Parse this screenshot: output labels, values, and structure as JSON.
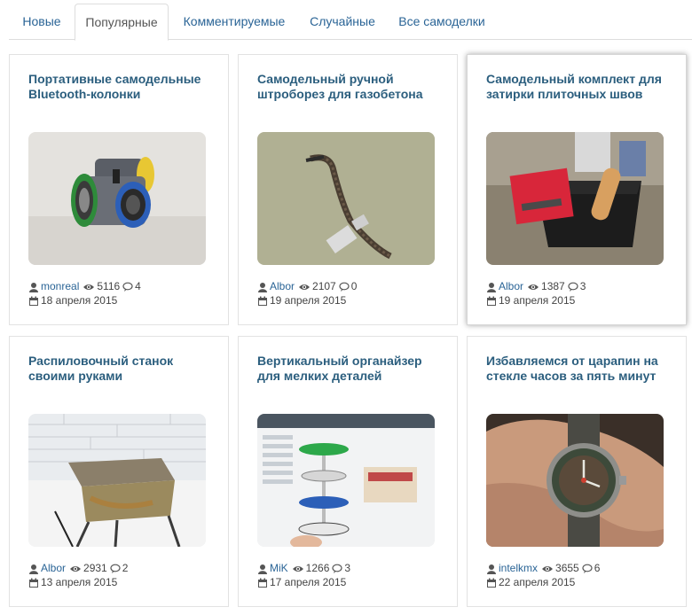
{
  "tabs": [
    {
      "label": "Новые",
      "active": false
    },
    {
      "label": "Популярные",
      "active": true
    },
    {
      "label": "Комментируемые",
      "active": false
    },
    {
      "label": "Случайные",
      "active": false
    },
    {
      "label": "Все самоделки",
      "active": false
    }
  ],
  "colors": {
    "link": "#2a6496",
    "title": "#2b5e7e",
    "border": "#dddddd"
  },
  "posts": [
    {
      "title": "Портативные самодельные Bluetooth-колонки",
      "author": "monreal",
      "views": "5116",
      "comments": "4",
      "date": "18 апреля 2015",
      "image": "bluetooth-speaker"
    },
    {
      "title": "Самодельный ручной штроборез для газобетона",
      "author": "Albor",
      "views": "2107",
      "comments": "0",
      "date": "19 апреля 2015",
      "image": "wall-chaser-tool"
    },
    {
      "title": "Самодельный комплект для затирки плиточных швов",
      "author": "Albor",
      "views": "1387",
      "comments": "3",
      "date": "19 апреля 2015",
      "image": "grout-kit"
    },
    {
      "title": "Распиловочный станок своими руками",
      "author": "Albor",
      "views": "2931",
      "comments": "2",
      "date": "13 апреля 2015",
      "image": "saw-table"
    },
    {
      "title": "Вертикальный органайзер для мелких деталей",
      "author": "MiK",
      "views": "1266",
      "comments": "3",
      "date": "17 апреля 2015",
      "image": "parts-organizer"
    },
    {
      "title": "Избавляемся от царапин на стекле часов за пять минут",
      "author": "intelkmx",
      "views": "3655",
      "comments": "6",
      "date": "22 апреля 2015",
      "image": "wristwatch"
    }
  ]
}
